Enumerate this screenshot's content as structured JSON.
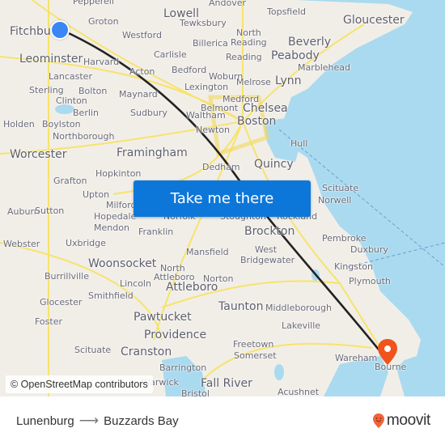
{
  "map": {
    "origin": "Lunenburg",
    "destination": "Buzzards Bay",
    "colors": {
      "land": "#f1eee8",
      "water": "#aadaef",
      "roads": "#f7e36a",
      "route_line": "#222222",
      "origin_marker": "#3a86f5",
      "destination_marker": "#f0531c",
      "button": "#0d77d9"
    },
    "places": [
      {
        "name": "Pepperell",
        "size": "s"
      },
      {
        "name": "Lowell",
        "size": "m"
      },
      {
        "name": "Andover",
        "size": "s"
      },
      {
        "name": "Topsfield",
        "size": "s"
      },
      {
        "name": "Gloucester",
        "size": "m"
      },
      {
        "name": "Fitchburg",
        "size": "m"
      },
      {
        "name": "Groton",
        "size": "s"
      },
      {
        "name": "Westford",
        "size": "s"
      },
      {
        "name": "Tewksbury",
        "size": "s"
      },
      {
        "name": "North",
        "size": "s"
      },
      {
        "name": "Reading",
        "size": "s"
      },
      {
        "name": "Beverly",
        "size": "m"
      },
      {
        "name": "Leominster",
        "size": "m"
      },
      {
        "name": "Harvard",
        "size": "s"
      },
      {
        "name": "Billerica",
        "size": "s"
      },
      {
        "name": "Carlisle",
        "size": "s"
      },
      {
        "name": "Reading",
        "size": "s"
      },
      {
        "name": "Peabody",
        "size": "m"
      },
      {
        "name": "Marblehead",
        "size": "s"
      },
      {
        "name": "Lancaster",
        "size": "s"
      },
      {
        "name": "Acton",
        "size": "s"
      },
      {
        "name": "Bedford",
        "size": "s"
      },
      {
        "name": "Woburn",
        "size": "s"
      },
      {
        "name": "Melrose",
        "size": "s"
      },
      {
        "name": "Lynn",
        "size": "m"
      },
      {
        "name": "Sterling",
        "size": "s"
      },
      {
        "name": "Bolton",
        "size": "s"
      },
      {
        "name": "Maynard",
        "size": "s"
      },
      {
        "name": "Lexington",
        "size": "s"
      },
      {
        "name": "Clinton",
        "size": "s"
      },
      {
        "name": "Medford",
        "size": "s"
      },
      {
        "name": "Belmont",
        "size": "s"
      },
      {
        "name": "Chelsea",
        "size": "m"
      },
      {
        "name": "Berlin",
        "size": "s"
      },
      {
        "name": "Holden",
        "size": "s"
      },
      {
        "name": "Boylston",
        "size": "s"
      },
      {
        "name": "Sudbury",
        "size": "s"
      },
      {
        "name": "Waltham",
        "size": "s"
      },
      {
        "name": "Boston",
        "size": "m"
      },
      {
        "name": "Newton",
        "size": "s"
      },
      {
        "name": "Northborough",
        "size": "s"
      },
      {
        "name": "Hull",
        "size": "s"
      },
      {
        "name": "Worcester",
        "size": "m"
      },
      {
        "name": "Framingham",
        "size": "m"
      },
      {
        "name": "Grafton",
        "size": "s"
      },
      {
        "name": "Hopkinton",
        "size": "s"
      },
      {
        "name": "Dedham",
        "size": "s"
      },
      {
        "name": "Quincy",
        "size": "m"
      },
      {
        "name": "Auburn",
        "size": "s"
      },
      {
        "name": "Scituate",
        "size": "s"
      },
      {
        "name": "Upton",
        "size": "s"
      },
      {
        "name": "Milford",
        "size": "s"
      },
      {
        "name": "Norwell",
        "size": "s"
      },
      {
        "name": "Sutton",
        "size": "s"
      },
      {
        "name": "Hopedale",
        "size": "s"
      },
      {
        "name": "Norfolk",
        "size": "s"
      },
      {
        "name": "Stoughton",
        "size": "s"
      },
      {
        "name": "Rockland",
        "size": "s"
      },
      {
        "name": "Mendon",
        "size": "s"
      },
      {
        "name": "Franklin",
        "size": "s"
      },
      {
        "name": "Brockton",
        "size": "m"
      },
      {
        "name": "Pembroke",
        "size": "s"
      },
      {
        "name": "Webster",
        "size": "s"
      },
      {
        "name": "Uxbridge",
        "size": "s"
      },
      {
        "name": "Duxbury",
        "size": "s"
      },
      {
        "name": "Mansfield",
        "size": "s"
      },
      {
        "name": "West",
        "size": "s"
      },
      {
        "name": "Bridgewater",
        "size": "s"
      },
      {
        "name": "Woonsocket",
        "size": "m"
      },
      {
        "name": "Kingston",
        "size": "s"
      },
      {
        "name": "North",
        "size": "s"
      },
      {
        "name": "Burrillville",
        "size": "s"
      },
      {
        "name": "Attleboro",
        "size": "s"
      },
      {
        "name": "Norton",
        "size": "s"
      },
      {
        "name": "Lincoln",
        "size": "s"
      },
      {
        "name": "Plymouth",
        "size": "s"
      },
      {
        "name": "Attleboro",
        "size": "m"
      },
      {
        "name": "Glocester",
        "size": "s"
      },
      {
        "name": "Smithfield",
        "size": "s"
      },
      {
        "name": "Taunton",
        "size": "m"
      },
      {
        "name": "Middleborough",
        "size": "s"
      },
      {
        "name": "Pawtucket",
        "size": "m"
      },
      {
        "name": "Foster",
        "size": "s"
      },
      {
        "name": "Lakeville",
        "size": "s"
      },
      {
        "name": "Providence",
        "size": "m"
      },
      {
        "name": "Freetown",
        "size": "s"
      },
      {
        "name": "Scituate",
        "size": "s"
      },
      {
        "name": "Cranston",
        "size": "m"
      },
      {
        "name": "Somerset",
        "size": "s"
      },
      {
        "name": "Wareham",
        "size": "s"
      },
      {
        "name": "Bourne",
        "size": "s"
      },
      {
        "name": "Barrington",
        "size": "s"
      },
      {
        "name": "Fall River",
        "size": "m"
      },
      {
        "name": "Warwick",
        "size": "s"
      },
      {
        "name": "Bristol",
        "size": "s"
      },
      {
        "name": "Acushnet",
        "size": "s"
      }
    ],
    "attribution": "© OpenStreetMap contributors"
  },
  "cta": {
    "label": "Take me there"
  },
  "footer": {
    "from": "Lunenburg",
    "arrow": "⟶",
    "to": "Buzzards Bay",
    "brand": "moovit"
  }
}
